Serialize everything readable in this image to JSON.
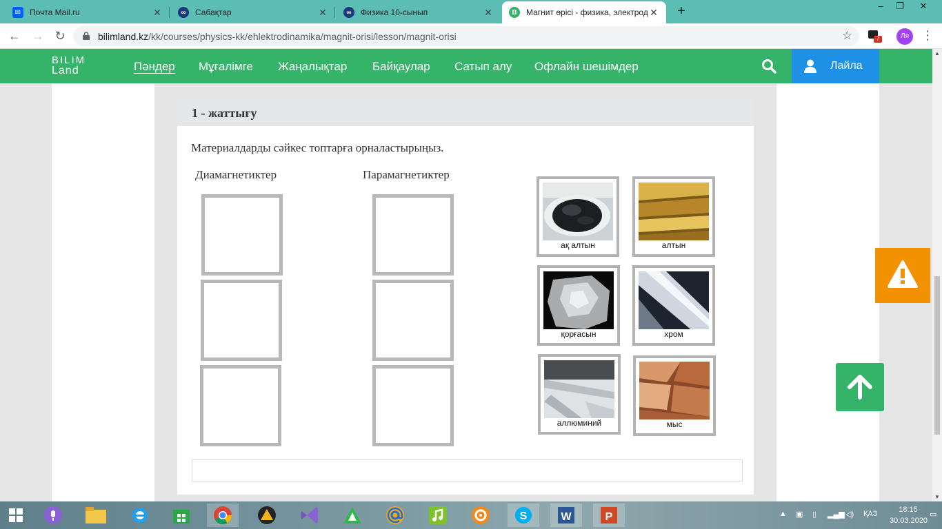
{
  "browser": {
    "tabs": [
      {
        "title": "Почта Mail.ru",
        "icon": "mail-icon",
        "color": "#005ff9"
      },
      {
        "title": "Сабақтар",
        "icon": "globe-icon",
        "color": "#1a3a7a"
      },
      {
        "title": "Физика 10-сынып",
        "icon": "globe-icon",
        "color": "#1a3a7a"
      },
      {
        "title": "Магнит өрісі - физика, электрод",
        "icon": "bilimland-icon",
        "color": "#35b369"
      }
    ],
    "url_host": "bilimland.kz",
    "url_path": "/kk/courses/physics-kk/ehlektrodinamika/magnit-orisi/lesson/magnit-orisi",
    "extension_badge": "7",
    "profile": "Ля"
  },
  "site": {
    "logo_top": "BILIM",
    "logo_bottom": "Land",
    "nav": [
      "Пәндер",
      "Мұғалімге",
      "Жаңалықтар",
      "Байқаулар",
      "Сатып алу",
      "Офлайн шешімдер"
    ],
    "user_label": "Лайла",
    "brand_color": "#35b369"
  },
  "exercise": {
    "title": "1 - жаттығу",
    "instruction": "Материалдарды сәйкес топтарға орналастырыңыз.",
    "group_a": "Диамагнетиктер",
    "group_b": "Парамагнетиктер",
    "materials": [
      "ақ алтын",
      "алтын",
      "қорғасын",
      "хром",
      "аллюминий",
      "мыс"
    ]
  },
  "taskbar": {
    "lang": "ҚАЗ",
    "time": "18:15",
    "date": "30.03.2020"
  }
}
